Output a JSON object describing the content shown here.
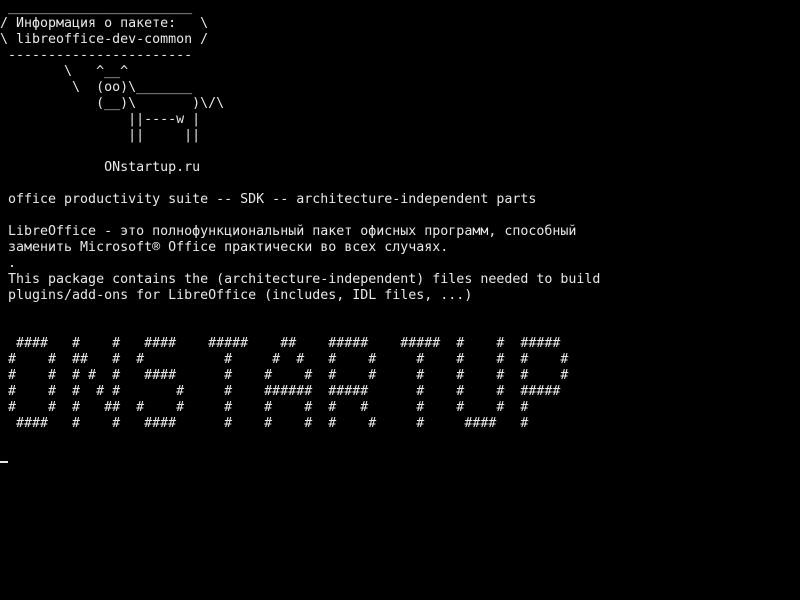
{
  "terminal": {
    "bubble_top": " _______________________",
    "bubble_line1": "/ Информация о пакете:   \\",
    "bubble_line2": "\\ libreoffice-dev-common /",
    "bubble_bottom": " -----------------------",
    "cow_line1": "        \\   ^__^",
    "cow_line2": "         \\  (oo)\\_______",
    "cow_line3": "            (__)\\       )\\/\\",
    "cow_line4": "                ||----w |",
    "cow_line5": "                ||     ||",
    "site": "             ONstartup.ru",
    "summary": " office productivity suite -- SDK -- architecture-independent parts",
    "desc_ru_1": " LibreOffice - это полнофункциональный пакет офисных программ, способный",
    "desc_ru_2": " заменить Microsoft® Office практически во всех случаях.",
    "desc_dot": " .",
    "desc_en_1": " This package contains the (architecture-independent) files needed to build",
    "desc_en_2": " plugins/add-ons for LibreOffice (includes, IDL files, ...)",
    "banner_1": "  ####   #    #   ####    #####    ##    #####    #####  #    #  #####",
    "banner_2": " #    #  ##   #  #          #     #  #   #    #     #    #    #  #    #",
    "banner_3": " #    #  # #  #   ####      #    #    #  #    #     #    #    #  #    #",
    "banner_4": " #    #  #  # #       #     #    ######  #####      #    #    #  #####",
    "banner_5": " #    #  #   ##  #    #     #    #    #  #   #      #    #    #  #",
    "banner_6": "  ####   #    #   ####      #    #    #  #    #     #     ####   #"
  },
  "colors": {
    "background": "#000000",
    "text": "#e8e8e8"
  }
}
